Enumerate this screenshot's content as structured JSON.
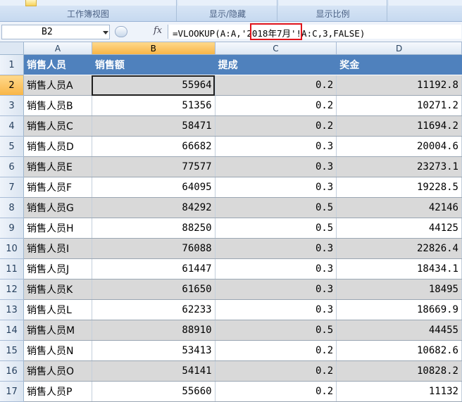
{
  "ribbon": {
    "groups": [
      {
        "label": "工作簿视图"
      },
      {
        "label": "显示/隐藏"
      },
      {
        "label": "显示比例"
      },
      {
        "label": ""
      }
    ]
  },
  "formula_bar": {
    "name_box": "B2",
    "fx_icon": "fx",
    "formula": "=VLOOKUP(A:A,'2018年7月'!A:C,3,FALSE)",
    "highlight_color": "#e0141b"
  },
  "sheet": {
    "selected_cell": "B2",
    "header_fill": "#4f81bd",
    "band_fill": "#d9d9d9",
    "columns": [
      "A",
      "B",
      "C",
      "D"
    ],
    "header_row": {
      "row": "1",
      "cells": [
        "销售人员",
        "销售额",
        "提成",
        "奖金"
      ]
    },
    "rows": [
      {
        "row": "2",
        "name": "销售人员A",
        "sales": "55964",
        "rate": "0.2",
        "bonus": "11192.8"
      },
      {
        "row": "3",
        "name": "销售人员B",
        "sales": "51356",
        "rate": "0.2",
        "bonus": "10271.2"
      },
      {
        "row": "4",
        "name": "销售人员C",
        "sales": "58471",
        "rate": "0.2",
        "bonus": "11694.2"
      },
      {
        "row": "5",
        "name": "销售人员D",
        "sales": "66682",
        "rate": "0.3",
        "bonus": "20004.6"
      },
      {
        "row": "6",
        "name": "销售人员E",
        "sales": "77577",
        "rate": "0.3",
        "bonus": "23273.1"
      },
      {
        "row": "7",
        "name": "销售人员F",
        "sales": "64095",
        "rate": "0.3",
        "bonus": "19228.5"
      },
      {
        "row": "8",
        "name": "销售人员G",
        "sales": "84292",
        "rate": "0.5",
        "bonus": "42146"
      },
      {
        "row": "9",
        "name": "销售人员H",
        "sales": "88250",
        "rate": "0.5",
        "bonus": "44125"
      },
      {
        "row": "10",
        "name": "销售人员I",
        "sales": "76088",
        "rate": "0.3",
        "bonus": "22826.4"
      },
      {
        "row": "11",
        "name": "销售人员J",
        "sales": "61447",
        "rate": "0.3",
        "bonus": "18434.1"
      },
      {
        "row": "12",
        "name": "销售人员K",
        "sales": "61650",
        "rate": "0.3",
        "bonus": "18495"
      },
      {
        "row": "13",
        "name": "销售人员L",
        "sales": "62233",
        "rate": "0.3",
        "bonus": "18669.9"
      },
      {
        "row": "14",
        "name": "销售人员M",
        "sales": "88910",
        "rate": "0.5",
        "bonus": "44455"
      },
      {
        "row": "15",
        "name": "销售人员N",
        "sales": "53413",
        "rate": "0.2",
        "bonus": "10682.6"
      },
      {
        "row": "16",
        "name": "销售人员O",
        "sales": "54141",
        "rate": "0.2",
        "bonus": "10828.2"
      },
      {
        "row": "17",
        "name": "销售人员P",
        "sales": "55660",
        "rate": "0.2",
        "bonus": "11132"
      }
    ]
  }
}
